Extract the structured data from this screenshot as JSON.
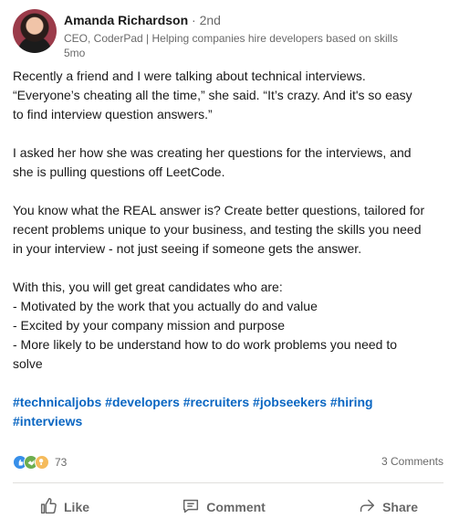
{
  "author": {
    "name": "Amanda Richardson",
    "degree": " · 2nd",
    "headline": "CEO, CoderPad | Helping companies hire developers based on skills",
    "time": "5mo"
  },
  "post": {
    "p1": "Recently a friend and I were talking about technical interviews.\n“Everyone’s cheating all the time,” she said. “It’s crazy. And it's so easy\nto find interview question answers.”",
    "p2": "I asked her how she was creating her questions for the interviews, and\nshe is pulling questions off LeetCode.",
    "p3": "You know what the REAL answer is? Create better questions, tailored for\nrecent problems unique to your business, and testing the skills you need\nin your interview - not just seeing if someone gets the answer.",
    "p4": "With this, you will get great candidates who are:\n- Motivated by the work that you actually do and value\n- Excited by your company mission and purpose\n- More likely to be understand how to do work problems you need to\nsolve"
  },
  "hashtags": [
    "#technicaljobs",
    "#developers",
    "#recruiters",
    "#jobseekers",
    "#hiring",
    "#interviews"
  ],
  "social": {
    "reaction_count": "73",
    "comments": "3 Comments"
  },
  "actions": {
    "like": "Like",
    "comment": "Comment",
    "share": "Share"
  },
  "colors": {
    "link": "#0a66c2",
    "like_reaction": "#378fe9",
    "support_reaction": "#6dae4f",
    "insight_reaction": "#f5bb5c"
  }
}
